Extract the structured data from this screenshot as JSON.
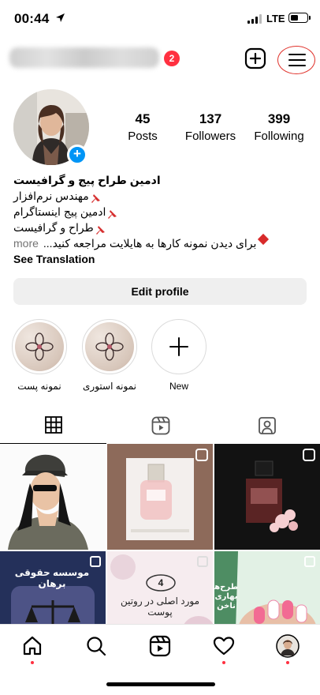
{
  "status_bar": {
    "time": "00:44",
    "network": "LTE",
    "battery_level": 0.45
  },
  "header": {
    "username": "",
    "notification_count": "2"
  },
  "profile": {
    "stats": [
      {
        "value": "45",
        "label": "Posts"
      },
      {
        "value": "137",
        "label": "Followers"
      },
      {
        "value": "399",
        "label": "Following"
      }
    ],
    "bio": {
      "name": "ادمین طراح پیج و گرافیست",
      "line1": "مهندس نرم‌افزار",
      "line2": "ادمین پیج اینستاگرام",
      "line3": "طراح و گرافیست",
      "line4": "برای دیدن نمونه کارها به هایلایت مراجعه کنید...",
      "more": "more",
      "see_translation": "See Translation"
    },
    "edit_profile_label": "Edit profile"
  },
  "highlights": [
    {
      "label": "نمونه پست",
      "icon": "flower-icon"
    },
    {
      "label": "نمونه استوری",
      "icon": "flower-icon"
    },
    {
      "label": "New",
      "icon": "plus-icon"
    }
  ],
  "tabs": [
    {
      "name": "posts-grid",
      "icon": "grid-icon",
      "active": true
    },
    {
      "name": "reels",
      "icon": "reels-icon",
      "active": false
    },
    {
      "name": "tagged",
      "icon": "tagged-icon",
      "active": false
    }
  ],
  "grid_posts": [
    {
      "type": "image",
      "text": ""
    },
    {
      "type": "reel",
      "text": ""
    },
    {
      "type": "reel",
      "text": ""
    },
    {
      "type": "carousel",
      "text": "موسسه حقوقی برهان"
    },
    {
      "type": "carousel",
      "number": "4",
      "text": "مورد اصلی در روتین پوست"
    },
    {
      "type": "carousel",
      "text": "طرح‌های بهاری ناخن"
    }
  ],
  "bottom_nav": [
    "home-icon",
    "search-icon",
    "reels-icon",
    "heart-icon",
    "profile-avatar"
  ],
  "colors": {
    "accent_blue": "#0095f6",
    "badge_red": "#ff3040",
    "annotation_red": "#e0322b"
  }
}
